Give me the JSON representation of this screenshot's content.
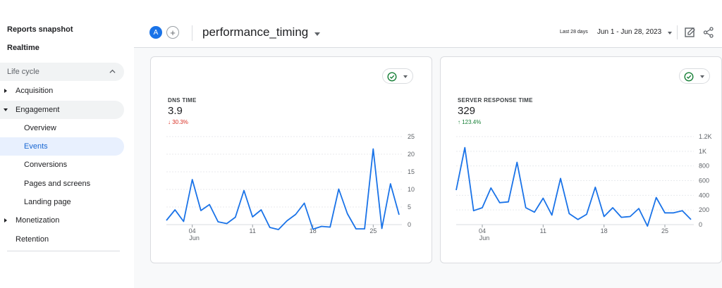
{
  "sidebar": {
    "reports_snapshot": "Reports snapshot",
    "realtime": "Realtime",
    "section_life_cycle": "Life cycle",
    "acquisition": "Acquisition",
    "engagement": "Engagement",
    "overview": "Overview",
    "events": "Events",
    "conversions": "Conversions",
    "pages_and_screens": "Pages and screens",
    "landing_page": "Landing page",
    "monetization": "Monetization",
    "retention": "Retention"
  },
  "header": {
    "avatar_letter": "A",
    "add_comparison": "+",
    "report_title": "performance_timing",
    "date_label": "Last 28 days",
    "date_range": "Jun 1 - Jun 28, 2023"
  },
  "colors": {
    "accent": "#1a73e8",
    "line": "#1a73e8",
    "positive": "#188038",
    "negative": "#d93025"
  },
  "icons": [
    "check-circle-icon",
    "chevron-down-icon",
    "chevron-up-icon",
    "edit-report-icon",
    "share-icon",
    "arrow-down-icon",
    "arrow-up-icon"
  ],
  "cards": [
    {
      "label": "DNS TIME",
      "value": "3.9",
      "change": "30.3%",
      "change_arrow": "↓",
      "direction": "down"
    },
    {
      "label": "SERVER RESPONSE TIME",
      "value": "329",
      "change": "123.4%",
      "change_arrow": "↑",
      "direction": "up"
    }
  ],
  "chart_data": [
    {
      "type": "line",
      "x_ticks": [
        "04",
        "11",
        "18",
        "25"
      ],
      "x_month": "Jun",
      "y_ticks": [
        "0",
        "5",
        "10",
        "15",
        "20",
        "25"
      ],
      "ylim": [
        0,
        25
      ],
      "grid": true,
      "x": [
        1,
        2,
        3,
        4,
        5,
        6,
        7,
        8,
        9,
        10,
        11,
        12,
        13,
        14,
        15,
        16,
        17,
        18,
        19,
        20,
        21,
        22,
        23,
        24,
        25,
        26,
        27,
        28
      ],
      "values": [
        1.2,
        4.2,
        0.9,
        12.8,
        4.0,
        5.7,
        0.8,
        0.3,
        2.1,
        9.7,
        2.2,
        4.2,
        -0.8,
        -1.4,
        1.1,
        2.9,
        6.1,
        -1.3,
        -0.5,
        -0.7,
        10.1,
        3.1,
        -1.2,
        -1.2,
        21.5,
        -1.1,
        11.6,
        2.8
      ]
    },
    {
      "type": "line",
      "x_ticks": [
        "04",
        "11",
        "18",
        "25"
      ],
      "x_month": "Jun",
      "y_ticks": [
        "0",
        "200",
        "400",
        "600",
        "800",
        "1K",
        "1.2K"
      ],
      "ylim": [
        0,
        1200
      ],
      "grid": true,
      "x": [
        1,
        2,
        3,
        4,
        5,
        6,
        7,
        8,
        9,
        10,
        11,
        12,
        13,
        14,
        15,
        16,
        17,
        18,
        19,
        20,
        21,
        22,
        23,
        24,
        25,
        26,
        27,
        28
      ],
      "values": [
        470,
        1050,
        190,
        230,
        500,
        300,
        310,
        850,
        230,
        170,
        360,
        130,
        630,
        150,
        70,
        140,
        510,
        110,
        230,
        100,
        110,
        220,
        -20,
        370,
        160,
        160,
        190,
        70
      ]
    }
  ]
}
